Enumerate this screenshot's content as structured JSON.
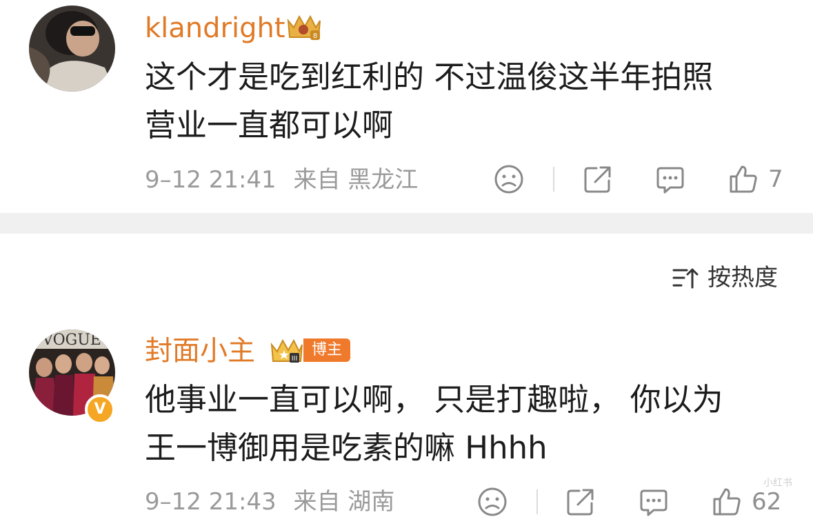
{
  "comments": [
    {
      "username": "klandright",
      "text_line1": "这个才是吃到红利的 不过温俊这半年拍照",
      "text_line2": "营业一直都可以啊",
      "time": "9–12 21:41",
      "location": "来自 黑龙江",
      "like_count": "7",
      "avatar_icon": "avatar-photo"
    },
    {
      "username": "封面小主",
      "badge_label": "博主",
      "text_line1": "他事业一直可以啊， 只是打趣啦， 你以为",
      "text_line2": "王一博御用是吃素的嘛 Hhhh",
      "time": "9–12 21:43",
      "location": "来自 湖南",
      "like_count": "62",
      "verified_mark": "V",
      "avatar_icon": "avatar-photo"
    }
  ],
  "sort": {
    "label": "按热度",
    "icon": "sort-icon"
  },
  "colors": {
    "username": "#e07a27",
    "accent_badge": "#f07a2c",
    "meta": "#9a9a9a",
    "divider": "#f0f0f0"
  },
  "watermark": "小红书"
}
